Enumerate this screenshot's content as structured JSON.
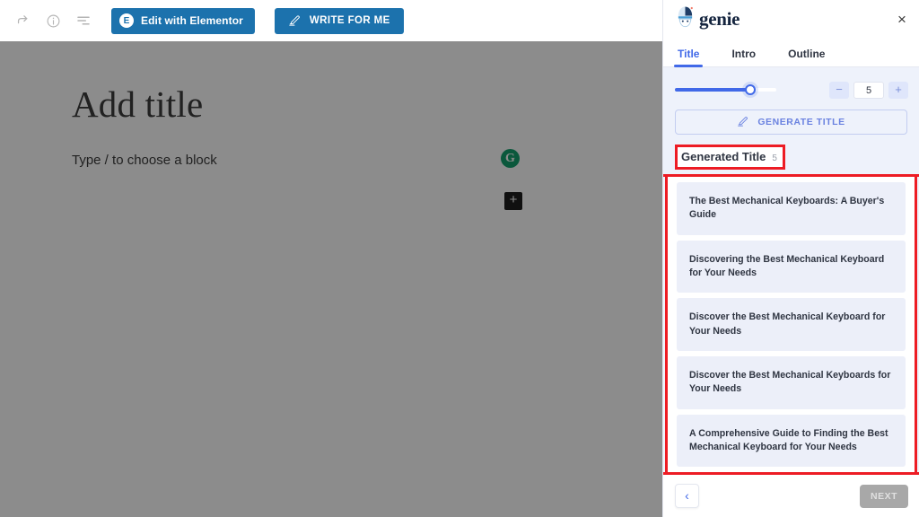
{
  "editor": {
    "toolbar": {
      "icons": [
        {
          "name": "redo-icon",
          "glyph": "redo"
        },
        {
          "name": "info-icon",
          "glyph": "info"
        },
        {
          "name": "details-list-icon",
          "glyph": "list"
        }
      ],
      "elementor_button": {
        "label": "Edit with Elementor",
        "badge": "E",
        "color": "#1c72ad"
      },
      "write_for_me_button": {
        "label": "WRITE FOR ME",
        "color": "#1c72ad"
      }
    },
    "canvas": {
      "title_placeholder": "Add title",
      "block_placeholder": "Type / to choose a block",
      "grammarly_badge": "G",
      "grammarly_color": "#15a06e",
      "inserter_glyph": "+"
    }
  },
  "panel": {
    "logo_text": "genie",
    "close_label": "×",
    "tabs": [
      {
        "label": "Title",
        "active": true
      },
      {
        "label": "Intro",
        "active": false
      },
      {
        "label": "Outline",
        "active": false
      }
    ],
    "accent_color": "#4169e8",
    "slider": {
      "value": 5,
      "percent": 75
    },
    "stepper": {
      "minus": "−",
      "plus": "+",
      "value": "5"
    },
    "generate_button": {
      "label": "GENERATE TITLE",
      "icon": "pencil-icon"
    },
    "results_header": {
      "label": "Generated Title",
      "count": "5"
    },
    "highlight_color": "#ed1c24",
    "titles": [
      "The Best Mechanical Keyboards: A Buyer's Guide",
      "Discovering the Best Mechanical Keyboard for Your Needs",
      "Discover the Best Mechanical Keyboard for Your Needs",
      "Discover the Best Mechanical Keyboards for Your Needs",
      "A Comprehensive Guide to Finding the Best Mechanical Keyboard for Your Needs"
    ],
    "footer": {
      "back_label": "‹",
      "next_label": "NEXT"
    }
  }
}
